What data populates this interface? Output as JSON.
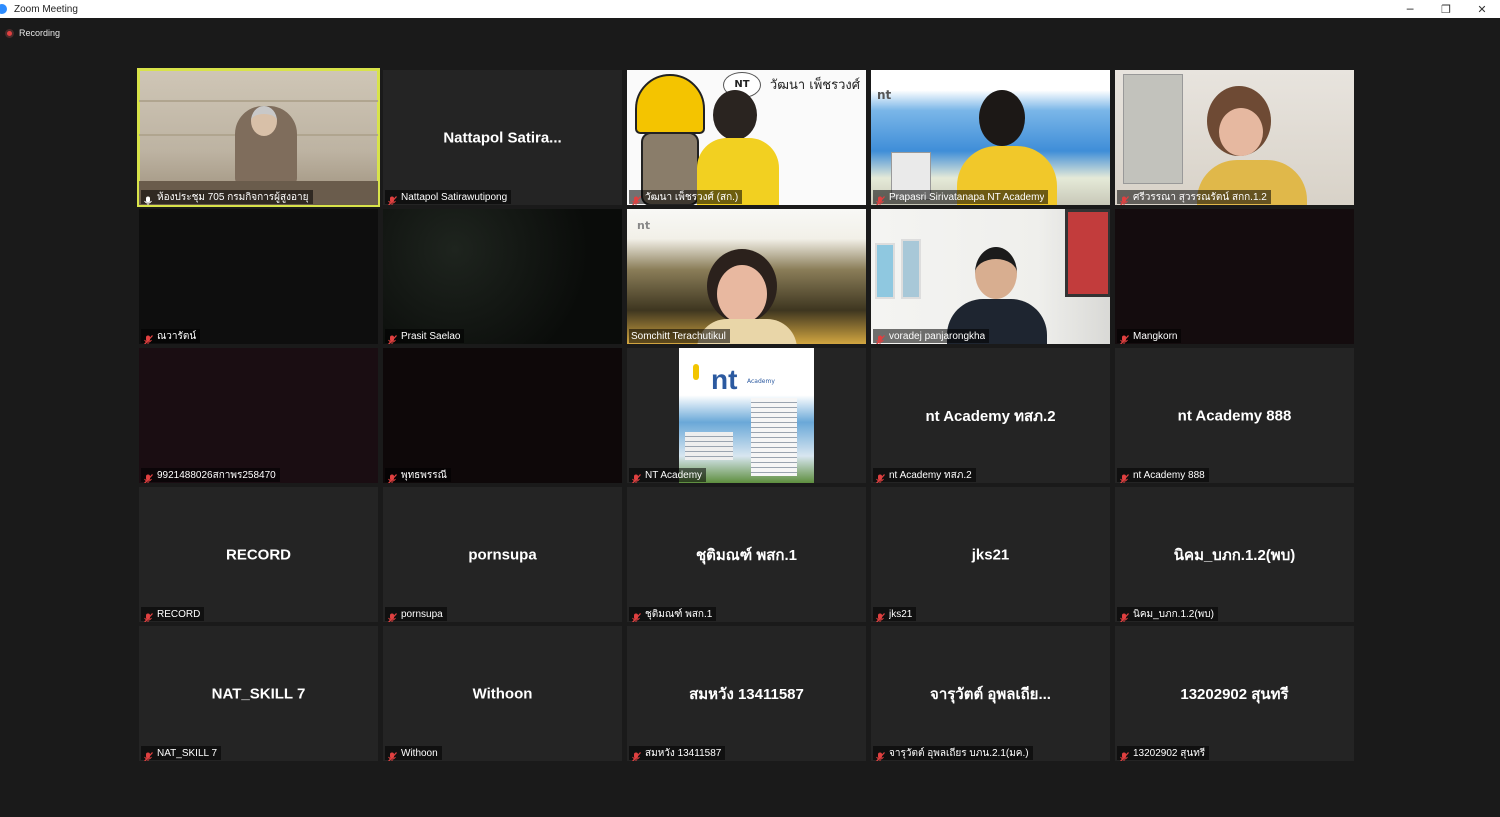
{
  "window": {
    "title": "Zoom Meeting",
    "controls": {
      "minimize": "─",
      "restore": "❐",
      "close": "✕"
    }
  },
  "recording": {
    "label": "Recording"
  },
  "colors": {
    "active_speaker_border": "#d8e34a",
    "recording_red": "#e04040",
    "muted_mic": "#e04040"
  },
  "tiles": [
    {
      "name": "ห้องประชุม 705 กรมกิจการผู้สูงอายุ",
      "display": "",
      "video": "room",
      "active": true,
      "mic": "unmuted"
    },
    {
      "name": "Nattapol Satirawutipong",
      "display": "Nattapol Satira...",
      "video": "none",
      "mic": "muted"
    },
    {
      "name": "วัฒนา เพ็ชรวงศ์ (สก.)",
      "display": "",
      "video": "yellow",
      "mic": "muted",
      "caption": "วัฒนา เพ็ชรวงศ์",
      "bubble": "NT"
    },
    {
      "name": "Prapasri Sirivatanapa NT Academy",
      "display": "",
      "video": "sky",
      "mic": "muted",
      "logo": "nt"
    },
    {
      "name": "ศรีวรรณา สุวรรณรัตน์ สกก.1.2",
      "display": "",
      "video": "office",
      "mic": "muted"
    },
    {
      "name": "ณวารัตน์",
      "display": "",
      "video": "dark1",
      "mic": "muted"
    },
    {
      "name": "Prasit Saelao",
      "display": "",
      "video": "dark2",
      "mic": "muted"
    },
    {
      "name": "Somchitt Terachutikul",
      "display": "",
      "video": "city",
      "mic": "none",
      "logo": "nt"
    },
    {
      "name": "voradej panjarongkha",
      "display": "",
      "video": "paint",
      "mic": "muted"
    },
    {
      "name": "Mangkorn",
      "display": "",
      "video": "dark3",
      "mic": "muted"
    },
    {
      "name": "9921488026สกาพร258470",
      "display": "",
      "video": "dark4",
      "mic": "muted"
    },
    {
      "name": "พุทธพรรณี",
      "display": "",
      "video": "dark5",
      "mic": "muted"
    },
    {
      "name": "NT Academy",
      "display": "",
      "video": "ntacademy",
      "mic": "muted",
      "logo": "nt",
      "academy": "Academy"
    },
    {
      "name": "nt Academy ทสภ.2",
      "display": "nt Academy ทสภ.2",
      "video": "none",
      "mic": "muted"
    },
    {
      "name": "nt Academy 888",
      "display": "nt Academy 888",
      "video": "none",
      "mic": "muted"
    },
    {
      "name": "RECORD",
      "display": "RECORD",
      "video": "none",
      "mic": "muted"
    },
    {
      "name": "pornsupa",
      "display": "pornsupa",
      "video": "none",
      "mic": "muted"
    },
    {
      "name": "ชุติมณฑ์ พสก.1",
      "display": "ชุติมณฑ์ พสก.1",
      "video": "none",
      "mic": "muted"
    },
    {
      "name": "jks21",
      "display": "jks21",
      "video": "none",
      "mic": "muted"
    },
    {
      "name": "นิคม_บภก.1.2(พบ)",
      "display": "นิคม_บภก.1.2(พบ)",
      "video": "none",
      "mic": "muted"
    },
    {
      "name": "NAT_SKILL 7",
      "display": "NAT_SKILL 7",
      "video": "none",
      "mic": "muted"
    },
    {
      "name": "Withoon",
      "display": "Withoon",
      "video": "none",
      "mic": "muted"
    },
    {
      "name": "สมหวัง 13411587",
      "display": "สมหวัง 13411587",
      "video": "none",
      "mic": "muted"
    },
    {
      "name": "จารุวัตต์ อุพลเถียร บภน.2.1(มค.)",
      "display": "จารุวัตต์ อุพลเถีย...",
      "video": "none",
      "mic": "muted"
    },
    {
      "name": "13202902 สุนทรี",
      "display": "13202902 สุนทรี",
      "video": "none",
      "mic": "muted"
    }
  ]
}
